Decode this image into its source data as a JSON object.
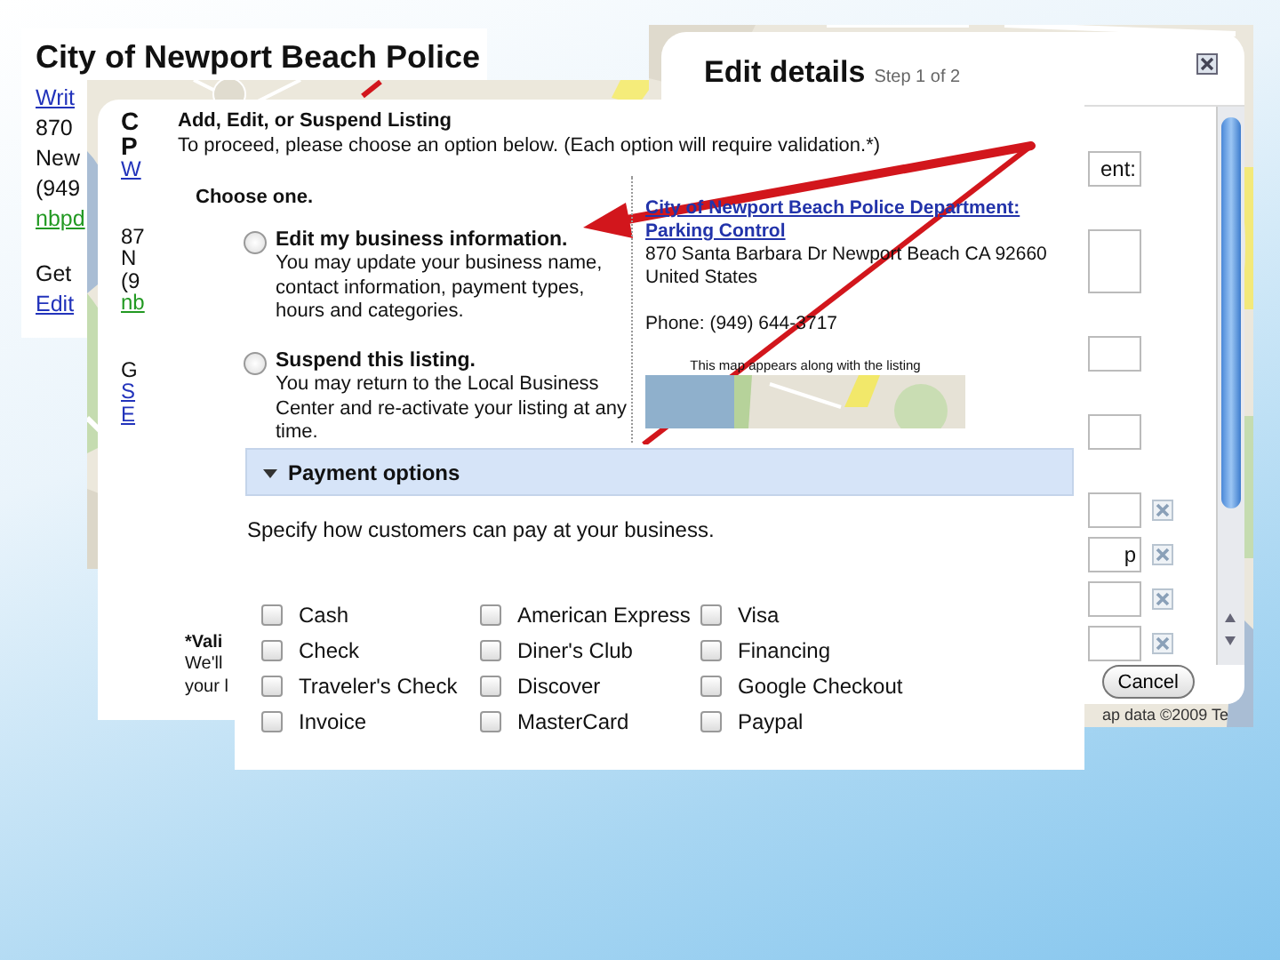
{
  "back_listing": {
    "title": "City of Newport Beach Police",
    "blocks": [
      [
        {
          "text": "Writ",
          "kind": "link"
        },
        {
          "text": "870",
          "kind": "text"
        },
        {
          "text": "New",
          "kind": "text"
        },
        {
          "text": "(949",
          "kind": "text"
        },
        {
          "text": "nbpd",
          "kind": "url"
        }
      ],
      [
        {
          "text": "Get",
          "kind": "text"
        },
        {
          "text": "Edit",
          "kind": "link"
        }
      ]
    ]
  },
  "edit_details": {
    "title": "Edit details",
    "step": "Step 1 of 2",
    "fields": [
      {
        "kind": "input",
        "value": "ent:",
        "removable": false
      },
      {
        "kind": "textarea",
        "removable": false
      },
      {
        "kind": "input",
        "removable": false
      },
      {
        "kind": "input",
        "removable": false
      },
      {
        "kind": "input",
        "removable": true
      },
      {
        "kind": "input",
        "value": "p",
        "removable": true
      },
      {
        "kind": "input",
        "removable": true
      },
      {
        "kind": "input",
        "removable": true
      }
    ],
    "cancel": "Cancel",
    "map_credit": "ap data ©2009 Te"
  },
  "listing_dialog": {
    "fragments": [
      [
        {
          "text": "C",
          "kind": "title"
        },
        {
          "text": "P",
          "kind": "title"
        },
        {
          "text": "W",
          "kind": "link"
        }
      ],
      [
        {
          "text": "87",
          "kind": "text"
        },
        {
          "text": "N",
          "kind": "text"
        },
        {
          "text": "(9",
          "kind": "text"
        },
        {
          "text": "nb",
          "kind": "url"
        }
      ],
      [
        {
          "text": "G",
          "kind": "text"
        },
        {
          "text": "S",
          "kind": "link"
        },
        {
          "text": "E",
          "kind": "link"
        }
      ]
    ],
    "heading": "Add, Edit, or Suspend Listing",
    "intro": "To proceed, please choose an option below. (Each option will require validation.*)",
    "prompt": "Choose one.",
    "options": [
      {
        "title": "Edit my business information.",
        "description": "You may update your business name, contact information, payment types, hours and categories.",
        "selected": false
      },
      {
        "title": "Suspend this listing.",
        "description": "You may return to the Local Business Center and re-activate your listing at any time.",
        "selected": false
      }
    ],
    "business": {
      "name": "City of Newport Beach Police Department: Parking Control",
      "address": "870 Santa Barbara Dr Newport Beach CA 92660",
      "country": "United States",
      "phone": "Phone: (949) 644-3717",
      "map_caption": "This map appears along with the listing"
    },
    "footnote": [
      "*Vali",
      "We'll",
      "your l"
    ]
  },
  "payment": {
    "title": "Payment options",
    "expanded": true,
    "prompt": "Specify how customers can pay at your business.",
    "methods": [
      {
        "label": "Cash",
        "checked": false
      },
      {
        "label": "Check",
        "checked": false
      },
      {
        "label": "Traveler's Check",
        "checked": false
      },
      {
        "label": "Invoice",
        "checked": false
      },
      {
        "label": "American Express",
        "checked": false
      },
      {
        "label": "Diner's Club",
        "checked": false
      },
      {
        "label": "Discover",
        "checked": false
      },
      {
        "label": "MasterCard",
        "checked": false
      },
      {
        "label": "Visa",
        "checked": false
      },
      {
        "label": "Financing",
        "checked": false
      },
      {
        "label": "Google Checkout",
        "checked": false
      },
      {
        "label": "Paypal",
        "checked": false
      }
    ]
  }
}
